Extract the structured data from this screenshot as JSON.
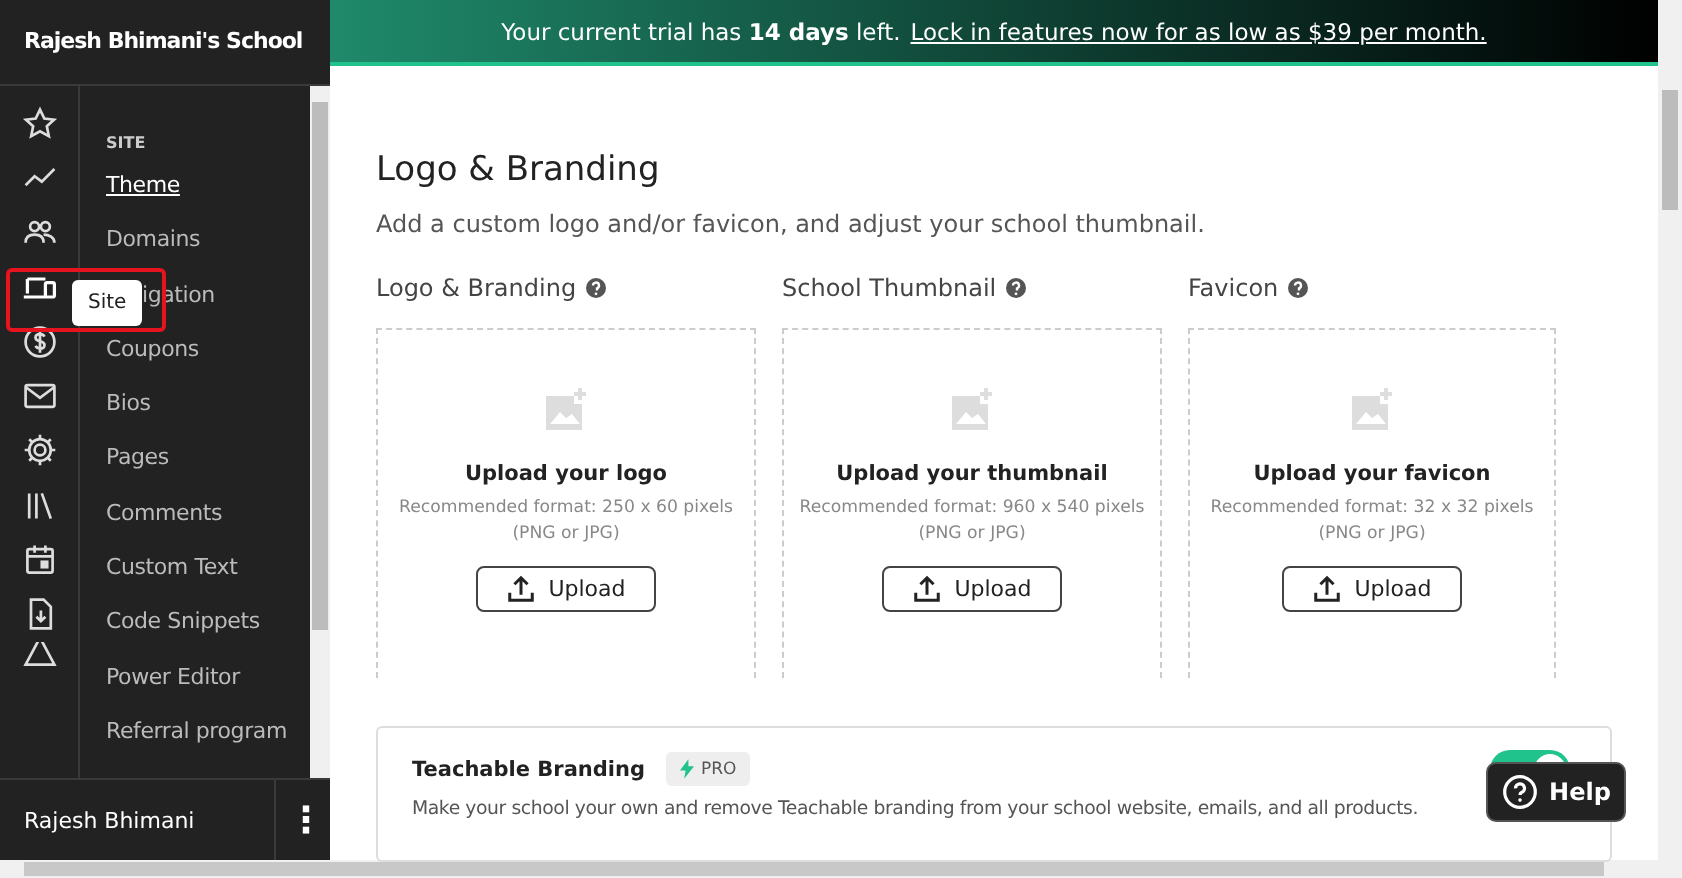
{
  "sidebar": {
    "school_name": "Rajesh Bhimani's School",
    "icons": [
      {
        "kind": "star",
        "selected": false
      },
      {
        "kind": "trend",
        "selected": false
      },
      {
        "kind": "people",
        "selected": false
      },
      {
        "kind": "devices",
        "selected": true
      },
      {
        "kind": "dollar",
        "selected": false
      },
      {
        "kind": "mail",
        "selected": false
      },
      {
        "kind": "gear",
        "selected": false
      },
      {
        "kind": "library",
        "selected": false
      },
      {
        "kind": "calendar",
        "selected": false
      },
      {
        "kind": "download",
        "selected": false
      },
      {
        "kind": "warning",
        "selected": false
      }
    ],
    "tooltip": "Site",
    "section_heading": "SITE",
    "items": [
      {
        "label": "Theme",
        "selected": true,
        "covered": false
      },
      {
        "label": "Domains",
        "selected": false,
        "covered": false
      },
      {
        "label": "igation",
        "selected": false,
        "covered": true
      },
      {
        "label": "Coupons",
        "selected": false,
        "covered": false
      },
      {
        "label": "Bios",
        "selected": false,
        "covered": false
      },
      {
        "label": "Pages",
        "selected": false,
        "covered": false
      },
      {
        "label": "Comments",
        "selected": false,
        "covered": false
      },
      {
        "label": "Custom Text",
        "selected": false,
        "covered": false
      },
      {
        "label": "Code Snippets",
        "selected": false,
        "covered": false
      },
      {
        "label": "Power Editor",
        "selected": false,
        "covered": false
      },
      {
        "label": "Referral program",
        "selected": false,
        "covered": false
      }
    ],
    "user_name": "Rajesh Bhimani",
    "menu_glyph": "⋮"
  },
  "banner": {
    "text": "Your current trial has **14 days** left.",
    "link": "Lock in features now for as low as $39 per month."
  },
  "page": {
    "title": "Logo & Branding",
    "subtitle": "Add a custom logo and/or favicon, and adjust your school thumbnail.",
    "uploads": [
      {
        "label": "Logo & Branding",
        "heading": "Upload your logo",
        "format": "Recommended format: 250 x 60 pixels",
        "types": "(PNG or JPG)",
        "button": "Upload"
      },
      {
        "label": "School Thumbnail",
        "heading": "Upload your thumbnail",
        "format": "Recommended format: 960 x 540 pixels",
        "types": "(PNG or JPG)",
        "button": "Upload"
      },
      {
        "label": "Favicon",
        "heading": "Upload your favicon",
        "format": "Recommended format: 32 x 32 pixels",
        "types": "(PNG or JPG)",
        "button": "Upload"
      }
    ],
    "branding": {
      "title": "Teachable Branding",
      "badge": "PRO",
      "description": "Make your school your own and remove Teachable branding from your school website, emails, and all products.",
      "on": true
    }
  },
  "help_button": "Help"
}
